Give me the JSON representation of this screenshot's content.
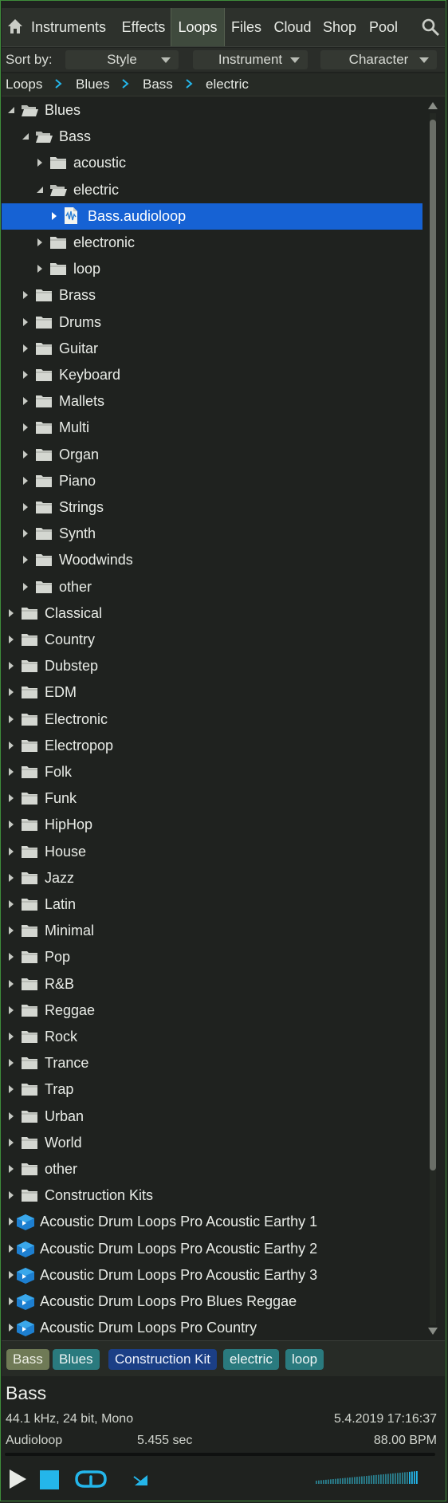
{
  "tabs": [
    {
      "label": "Instruments",
      "active": false
    },
    {
      "label": "Effects",
      "active": false
    },
    {
      "label": "Loops",
      "active": true
    },
    {
      "label": "Files",
      "active": false
    },
    {
      "label": "Cloud",
      "active": false
    },
    {
      "label": "Shop",
      "active": false
    },
    {
      "label": "Pool",
      "active": false
    }
  ],
  "sort": {
    "label": "Sort by:",
    "options": [
      "Style",
      "Instrument",
      "Character"
    ]
  },
  "breadcrumb": [
    "Loops",
    "Blues",
    "Bass",
    "electric"
  ],
  "tree": [
    {
      "label": "Blues",
      "level": 0,
      "expanded": true,
      "type": "folder"
    },
    {
      "label": "Bass",
      "level": 1,
      "expanded": true,
      "type": "folder"
    },
    {
      "label": "acoustic",
      "level": 2,
      "expanded": false,
      "type": "folder"
    },
    {
      "label": "electric",
      "level": 2,
      "expanded": true,
      "type": "folder"
    },
    {
      "label": "Bass.audioloop",
      "level": 3,
      "expanded": false,
      "type": "file",
      "selected": true
    },
    {
      "label": "electronic",
      "level": 2,
      "expanded": false,
      "type": "folder"
    },
    {
      "label": "loop",
      "level": 2,
      "expanded": false,
      "type": "folder"
    },
    {
      "label": "Brass",
      "level": 1,
      "expanded": false,
      "type": "folder"
    },
    {
      "label": "Drums",
      "level": 1,
      "expanded": false,
      "type": "folder"
    },
    {
      "label": "Guitar",
      "level": 1,
      "expanded": false,
      "type": "folder"
    },
    {
      "label": "Keyboard",
      "level": 1,
      "expanded": false,
      "type": "folder"
    },
    {
      "label": "Mallets",
      "level": 1,
      "expanded": false,
      "type": "folder"
    },
    {
      "label": "Multi",
      "level": 1,
      "expanded": false,
      "type": "folder"
    },
    {
      "label": "Organ",
      "level": 1,
      "expanded": false,
      "type": "folder"
    },
    {
      "label": "Piano",
      "level": 1,
      "expanded": false,
      "type": "folder"
    },
    {
      "label": "Strings",
      "level": 1,
      "expanded": false,
      "type": "folder"
    },
    {
      "label": "Synth",
      "level": 1,
      "expanded": false,
      "type": "folder"
    },
    {
      "label": "Woodwinds",
      "level": 1,
      "expanded": false,
      "type": "folder"
    },
    {
      "label": "other",
      "level": 1,
      "expanded": false,
      "type": "folder"
    },
    {
      "label": "Classical",
      "level": 0,
      "expanded": false,
      "type": "folder"
    },
    {
      "label": "Country",
      "level": 0,
      "expanded": false,
      "type": "folder"
    },
    {
      "label": "Dubstep",
      "level": 0,
      "expanded": false,
      "type": "folder"
    },
    {
      "label": "EDM",
      "level": 0,
      "expanded": false,
      "type": "folder"
    },
    {
      "label": "Electronic",
      "level": 0,
      "expanded": false,
      "type": "folder"
    },
    {
      "label": "Electropop",
      "level": 0,
      "expanded": false,
      "type": "folder"
    },
    {
      "label": "Folk",
      "level": 0,
      "expanded": false,
      "type": "folder"
    },
    {
      "label": "Funk",
      "level": 0,
      "expanded": false,
      "type": "folder"
    },
    {
      "label": "HipHop",
      "level": 0,
      "expanded": false,
      "type": "folder"
    },
    {
      "label": "House",
      "level": 0,
      "expanded": false,
      "type": "folder"
    },
    {
      "label": "Jazz",
      "level": 0,
      "expanded": false,
      "type": "folder"
    },
    {
      "label": "Latin",
      "level": 0,
      "expanded": false,
      "type": "folder"
    },
    {
      "label": "Minimal",
      "level": 0,
      "expanded": false,
      "type": "folder"
    },
    {
      "label": "Pop",
      "level": 0,
      "expanded": false,
      "type": "folder"
    },
    {
      "label": "R&B",
      "level": 0,
      "expanded": false,
      "type": "folder"
    },
    {
      "label": "Reggae",
      "level": 0,
      "expanded": false,
      "type": "folder"
    },
    {
      "label": "Rock",
      "level": 0,
      "expanded": false,
      "type": "folder"
    },
    {
      "label": "Trance",
      "level": 0,
      "expanded": false,
      "type": "folder"
    },
    {
      "label": "Trap",
      "level": 0,
      "expanded": false,
      "type": "folder"
    },
    {
      "label": "Urban",
      "level": 0,
      "expanded": false,
      "type": "folder"
    },
    {
      "label": "World",
      "level": 0,
      "expanded": false,
      "type": "folder"
    },
    {
      "label": "other",
      "level": 0,
      "expanded": false,
      "type": "folder"
    },
    {
      "label": "Construction Kits",
      "level": 0,
      "expanded": false,
      "type": "folder"
    },
    {
      "label": "Acoustic Drum Loops Pro Acoustic Earthy 1",
      "level": 0,
      "expanded": false,
      "type": "package"
    },
    {
      "label": "Acoustic Drum Loops Pro Acoustic Earthy 2",
      "level": 0,
      "expanded": false,
      "type": "package"
    },
    {
      "label": "Acoustic Drum Loops Pro Acoustic Earthy 3",
      "level": 0,
      "expanded": false,
      "type": "package"
    },
    {
      "label": "Acoustic Drum Loops Pro Blues Reggae",
      "level": 0,
      "expanded": false,
      "type": "package"
    },
    {
      "label": "Acoustic Drum Loops Pro Country",
      "level": 0,
      "expanded": false,
      "type": "package"
    }
  ],
  "tags": [
    {
      "label": "Bass",
      "bg": "#6f7a56",
      "fg": "#eef0e6"
    },
    {
      "label": "Blues",
      "bg": "#2a7a7e",
      "fg": "#eef4f4"
    },
    {
      "label": "Construction Kit",
      "bg": "#1b3f86",
      "fg": "#eef2fb"
    },
    {
      "label": "electric",
      "bg": "#2a7a7e",
      "fg": "#eef4f4"
    },
    {
      "label": "loop",
      "bg": "#2a7a7e",
      "fg": "#eef4f4"
    }
  ],
  "info": {
    "name": "Bass",
    "format": "44.1 kHz, 24 bit, Mono",
    "date": "5.4.2019 17:16:37",
    "type": "Audioloop",
    "duration": "5.455 sec",
    "tempo": "88.00 BPM"
  },
  "icons": {
    "home": "home-icon",
    "search": "search-icon",
    "play": "play-icon",
    "stop": "stop-icon",
    "loop": "loop-icon",
    "autoplay": "autoplay-icon",
    "volume": "volume-icon"
  },
  "colors": {
    "accent": "#24b6ea",
    "selection": "#1662d4",
    "frame": "#3e8c3a"
  }
}
